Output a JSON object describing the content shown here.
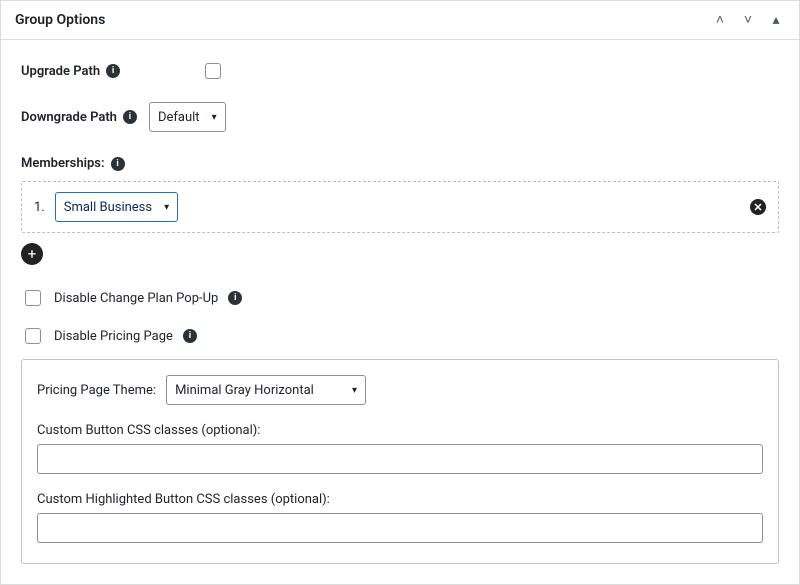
{
  "panel": {
    "title": "Group Options"
  },
  "fields": {
    "upgradePath": {
      "label": "Upgrade Path"
    },
    "downgradePath": {
      "label": "Downgrade Path",
      "value": "Default"
    },
    "memberships": {
      "label": "Memberships:",
      "items": [
        "Small Business"
      ],
      "firstIndex": "1."
    },
    "disableChangePlan": {
      "label": "Disable Change Plan Pop-Up"
    },
    "disablePricing": {
      "label": "Disable Pricing Page"
    },
    "pricingTheme": {
      "label": "Pricing Page Theme:",
      "value": "Minimal Gray Horizontal"
    },
    "customButtonCss": {
      "label": "Custom Button CSS classes (optional):",
      "value": ""
    },
    "customHighlightedCss": {
      "label": "Custom Highlighted Button CSS classes (optional):",
      "value": ""
    }
  },
  "icons": {
    "info": "i",
    "chevUp": "˄",
    "chevDown": "˅",
    "triUp": "▴",
    "add": "+",
    "remove": "✕",
    "caret": "▾"
  }
}
